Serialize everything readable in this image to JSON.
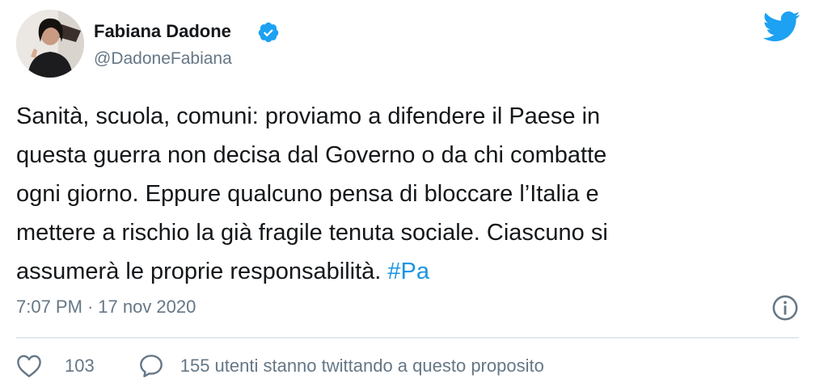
{
  "author": {
    "display_name": "Fabiana Dadone",
    "handle": "@DadoneFabiana",
    "verified": true
  },
  "tweet": {
    "lines": [
      "Sanità, scuola, comuni: proviamo a difendere il Paese in",
      "questa guerra non decisa dal Governo o da chi combatte",
      "ogni giorno. Eppure qualcuno pensa di bloccare l’Italia e",
      "mettere a rischio la già fragile tenuta sociale. Ciascuno si",
      "assumerà le proprie responsabilità."
    ],
    "hashtag": "#Pa"
  },
  "meta": {
    "time": "7:07 PM",
    "separator": "·",
    "date": "17 nov 2020"
  },
  "actions": {
    "like_count": "103",
    "conversation_text": "155 utenti stanno twittando a questo proposito"
  },
  "icons": {
    "brand": "twitter-bird-icon",
    "verified": "verified-badge-icon",
    "info": "info-icon",
    "like": "heart-icon",
    "reply": "speech-bubble-icon"
  },
  "colors": {
    "brand_blue": "#1da1f2",
    "link_blue": "#1b95e0",
    "text_primary": "#14171a",
    "text_secondary": "#657786",
    "divider": "#e1e8ed"
  }
}
